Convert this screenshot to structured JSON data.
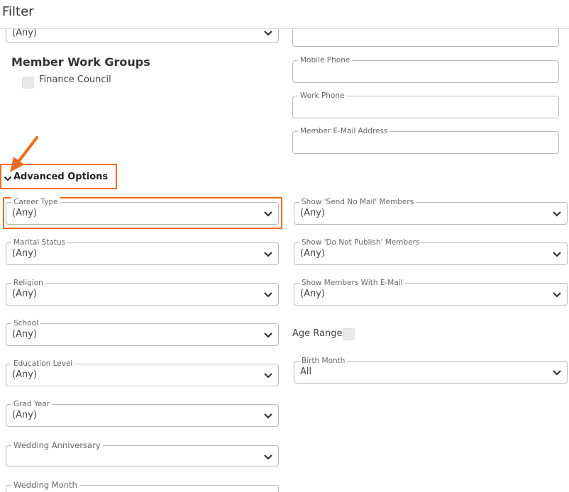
{
  "header": {
    "title": "Filter"
  },
  "top_section": {
    "partial_select_value": "(Any)",
    "member_work_groups": {
      "title": "Member Work Groups",
      "items": [
        {
          "label": "Finance Council",
          "checked": false
        }
      ]
    },
    "contact_fields": [
      {
        "label": "Mobile Phone",
        "value": ""
      },
      {
        "label": "Work Phone",
        "value": ""
      },
      {
        "label": "Member E-Mail Address",
        "value": ""
      }
    ]
  },
  "advanced": {
    "toggle_label": "Advanced Options",
    "left_fields": [
      {
        "label": "Career Type",
        "value": "(Any)"
      },
      {
        "label": "Marital Status",
        "value": "(Any)"
      },
      {
        "label": "Religion",
        "value": "(Any)"
      },
      {
        "label": "School",
        "value": "(Any)"
      },
      {
        "label": "Education Level",
        "value": "(Any)"
      },
      {
        "label": "Grad Year",
        "value": "(Any)"
      },
      {
        "label": "Wedding Anniversary",
        "value": ""
      },
      {
        "label": "Wedding Month",
        "value": ""
      }
    ],
    "right_fields": [
      {
        "label": "Show 'Send No Mail' Members",
        "value": "(Any)"
      },
      {
        "label": "Show 'Do Not Publish' Members",
        "value": "(Any)"
      },
      {
        "label": "Show Members With E-Mail",
        "value": "(Any)"
      },
      {
        "label": "Birth Month",
        "value": "All"
      }
    ],
    "age_range": {
      "label": "Age Range",
      "checked": false
    }
  },
  "annotation": {
    "color": "#f26a1b"
  },
  "icons": {
    "dropdown": "chevron-down-icon",
    "toggle": "chevron-down-icon",
    "pointer": "arrow-annotation-icon"
  }
}
